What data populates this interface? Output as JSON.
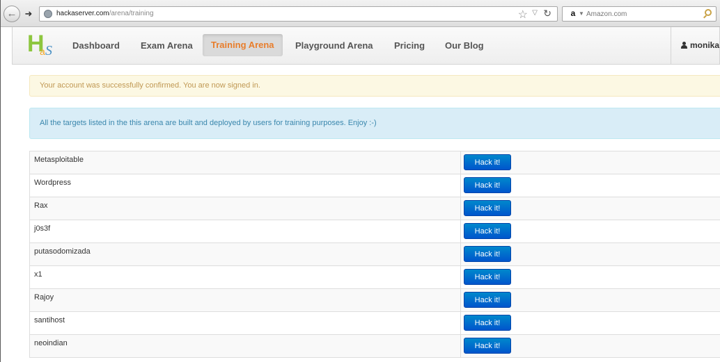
{
  "browser": {
    "url_domain": "hackaserver.com",
    "url_path": "/arena/training",
    "search_placeholder": "Amazon.com",
    "search_engine_letter": "a"
  },
  "site": {
    "logo": {
      "h": "H",
      "a": "a",
      "s": "S"
    },
    "nav": [
      {
        "label": "Dashboard",
        "active": false
      },
      {
        "label": "Exam Arena",
        "active": false
      },
      {
        "label": "Training Arena",
        "active": true
      },
      {
        "label": "Playground Arena",
        "active": false
      },
      {
        "label": "Pricing",
        "active": false
      },
      {
        "label": "Our Blog",
        "active": false
      }
    ],
    "user": "monika"
  },
  "alerts": {
    "success": "Your account was successfully confirmed. You are now signed in.",
    "info": "All the targets listed in the this arena are built and deployed by users for training purposes. Enjoy :-)"
  },
  "targets": [
    {
      "name": "Metasploitable",
      "button": "Hack it!"
    },
    {
      "name": "Wordpress",
      "button": "Hack it!"
    },
    {
      "name": "Rax",
      "button": "Hack it!"
    },
    {
      "name": "j0s3f",
      "button": "Hack it!"
    },
    {
      "name": "putasodomizada",
      "button": "Hack it!"
    },
    {
      "name": "x1",
      "button": "Hack it!"
    },
    {
      "name": "Rajoy",
      "button": "Hack it!"
    },
    {
      "name": "santihost",
      "button": "Hack it!"
    },
    {
      "name": "neoindian",
      "button": "Hack it!"
    }
  ]
}
